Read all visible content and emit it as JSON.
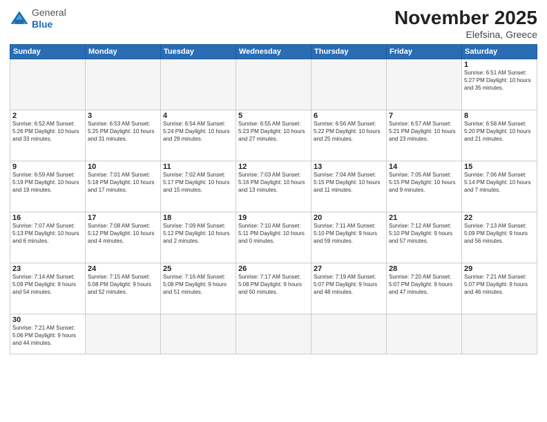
{
  "header": {
    "logo_general": "General",
    "logo_blue": "Blue",
    "month": "November 2025",
    "location": "Elefsina, Greece"
  },
  "days_of_week": [
    "Sunday",
    "Monday",
    "Tuesday",
    "Wednesday",
    "Thursday",
    "Friday",
    "Saturday"
  ],
  "weeks": [
    [
      {
        "day": "",
        "info": ""
      },
      {
        "day": "",
        "info": ""
      },
      {
        "day": "",
        "info": ""
      },
      {
        "day": "",
        "info": ""
      },
      {
        "day": "",
        "info": ""
      },
      {
        "day": "",
        "info": ""
      },
      {
        "day": "1",
        "info": "Sunrise: 6:51 AM\nSunset: 5:27 PM\nDaylight: 10 hours\nand 35 minutes."
      }
    ],
    [
      {
        "day": "2",
        "info": "Sunrise: 6:52 AM\nSunset: 5:26 PM\nDaylight: 10 hours\nand 33 minutes."
      },
      {
        "day": "3",
        "info": "Sunrise: 6:53 AM\nSunset: 5:25 PM\nDaylight: 10 hours\nand 31 minutes."
      },
      {
        "day": "4",
        "info": "Sunrise: 6:54 AM\nSunset: 5:24 PM\nDaylight: 10 hours\nand 29 minutes."
      },
      {
        "day": "5",
        "info": "Sunrise: 6:55 AM\nSunset: 5:23 PM\nDaylight: 10 hours\nand 27 minutes."
      },
      {
        "day": "6",
        "info": "Sunrise: 6:56 AM\nSunset: 5:22 PM\nDaylight: 10 hours\nand 25 minutes."
      },
      {
        "day": "7",
        "info": "Sunrise: 6:57 AM\nSunset: 5:21 PM\nDaylight: 10 hours\nand 23 minutes."
      },
      {
        "day": "8",
        "info": "Sunrise: 6:58 AM\nSunset: 5:20 PM\nDaylight: 10 hours\nand 21 minutes."
      }
    ],
    [
      {
        "day": "9",
        "info": "Sunrise: 6:59 AM\nSunset: 5:19 PM\nDaylight: 10 hours\nand 19 minutes."
      },
      {
        "day": "10",
        "info": "Sunrise: 7:01 AM\nSunset: 5:18 PM\nDaylight: 10 hours\nand 17 minutes."
      },
      {
        "day": "11",
        "info": "Sunrise: 7:02 AM\nSunset: 5:17 PM\nDaylight: 10 hours\nand 15 minutes."
      },
      {
        "day": "12",
        "info": "Sunrise: 7:03 AM\nSunset: 5:16 PM\nDaylight: 10 hours\nand 13 minutes."
      },
      {
        "day": "13",
        "info": "Sunrise: 7:04 AM\nSunset: 5:15 PM\nDaylight: 10 hours\nand 11 minutes."
      },
      {
        "day": "14",
        "info": "Sunrise: 7:05 AM\nSunset: 5:15 PM\nDaylight: 10 hours\nand 9 minutes."
      },
      {
        "day": "15",
        "info": "Sunrise: 7:06 AM\nSunset: 5:14 PM\nDaylight: 10 hours\nand 7 minutes."
      }
    ],
    [
      {
        "day": "16",
        "info": "Sunrise: 7:07 AM\nSunset: 5:13 PM\nDaylight: 10 hours\nand 6 minutes."
      },
      {
        "day": "17",
        "info": "Sunrise: 7:08 AM\nSunset: 5:12 PM\nDaylight: 10 hours\nand 4 minutes."
      },
      {
        "day": "18",
        "info": "Sunrise: 7:09 AM\nSunset: 5:12 PM\nDaylight: 10 hours\nand 2 minutes."
      },
      {
        "day": "19",
        "info": "Sunrise: 7:10 AM\nSunset: 5:11 PM\nDaylight: 10 hours\nand 0 minutes."
      },
      {
        "day": "20",
        "info": "Sunrise: 7:11 AM\nSunset: 5:10 PM\nDaylight: 9 hours\nand 59 minutes."
      },
      {
        "day": "21",
        "info": "Sunrise: 7:12 AM\nSunset: 5:10 PM\nDaylight: 9 hours\nand 57 minutes."
      },
      {
        "day": "22",
        "info": "Sunrise: 7:13 AM\nSunset: 5:09 PM\nDaylight: 9 hours\nand 56 minutes."
      }
    ],
    [
      {
        "day": "23",
        "info": "Sunrise: 7:14 AM\nSunset: 5:09 PM\nDaylight: 9 hours\nand 54 minutes."
      },
      {
        "day": "24",
        "info": "Sunrise: 7:15 AM\nSunset: 5:08 PM\nDaylight: 9 hours\nand 52 minutes."
      },
      {
        "day": "25",
        "info": "Sunrise: 7:16 AM\nSunset: 5:08 PM\nDaylight: 9 hours\nand 51 minutes."
      },
      {
        "day": "26",
        "info": "Sunrise: 7:17 AM\nSunset: 5:08 PM\nDaylight: 9 hours\nand 50 minutes."
      },
      {
        "day": "27",
        "info": "Sunrise: 7:19 AM\nSunset: 5:07 PM\nDaylight: 9 hours\nand 48 minutes."
      },
      {
        "day": "28",
        "info": "Sunrise: 7:20 AM\nSunset: 5:07 PM\nDaylight: 9 hours\nand 47 minutes."
      },
      {
        "day": "29",
        "info": "Sunrise: 7:21 AM\nSunset: 5:07 PM\nDaylight: 9 hours\nand 46 minutes."
      }
    ],
    [
      {
        "day": "30",
        "info": "Sunrise: 7:21 AM\nSunset: 5:06 PM\nDaylight: 9 hours\nand 44 minutes."
      },
      {
        "day": "",
        "info": ""
      },
      {
        "day": "",
        "info": ""
      },
      {
        "day": "",
        "info": ""
      },
      {
        "day": "",
        "info": ""
      },
      {
        "day": "",
        "info": ""
      },
      {
        "day": "",
        "info": ""
      }
    ]
  ]
}
